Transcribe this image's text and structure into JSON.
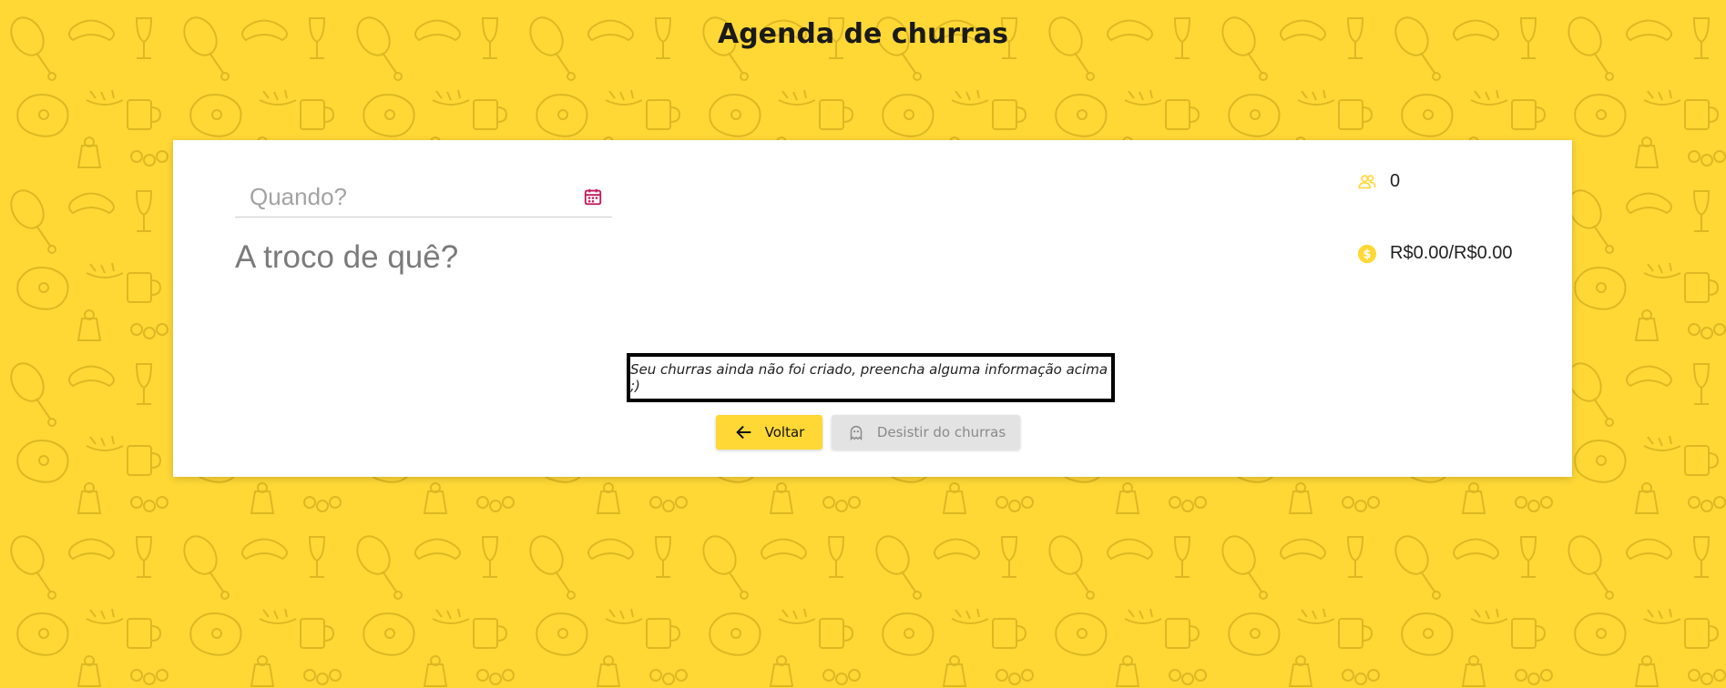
{
  "header": {
    "title": "Agenda de churras"
  },
  "form": {
    "date_placeholder": "Quando?",
    "date_value": "",
    "description_placeholder": "A troco de quê?",
    "description_value": ""
  },
  "stats": {
    "people_icon": "people-icon",
    "people_count": "0",
    "money_icon": "dollar-coin-icon",
    "money_text": "R$0.00/R$0.00"
  },
  "notice": {
    "text": "Seu churras ainda não foi criado, preencha alguma informação acima ;)"
  },
  "actions": {
    "back_label": "Voltar",
    "back_icon": "arrow-left-icon",
    "cancel_label": "Desistir do churras",
    "cancel_icon": "ghost-icon"
  },
  "colors": {
    "background": "#FFD836",
    "accent": "#FFD836",
    "calendar_icon": "#C2185B",
    "disabled_button": "#E3E3E3"
  }
}
